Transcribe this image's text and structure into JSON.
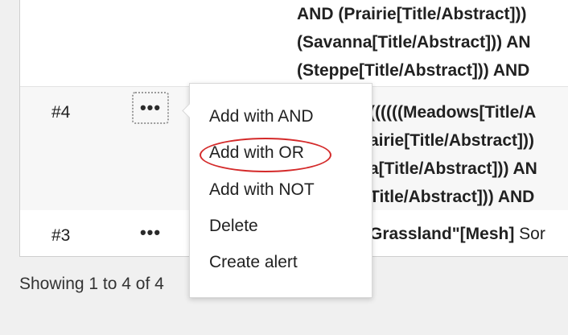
{
  "history": {
    "rows": [
      {
        "number": "",
        "query_lines": [
          "AND (Prairie[Title/Abstract]))",
          "(Savanna[Title/Abstract])) AN",
          "(Steppe[Title/Abstract])) AND"
        ]
      },
      {
        "number": "#4",
        "actions_glyph": "•••",
        "query_lines": [
          "((((((Meadows[Title/A",
          "airie[Title/Abstract]))",
          "a[Title/Abstract])) AN",
          "Title/Abstract])) AND"
        ]
      },
      {
        "number": "#3",
        "actions_glyph": "•••",
        "query_bold": "Grassland\"[Mesh]",
        "query_rest": " Sor"
      }
    ]
  },
  "context_menu": {
    "items": [
      "Add with AND",
      "Add with OR",
      "Add with NOT",
      "Delete",
      "Create alert"
    ],
    "highlight_color": "#d42a2a"
  },
  "footer": {
    "showing": "Showing 1 to 4 of 4"
  }
}
